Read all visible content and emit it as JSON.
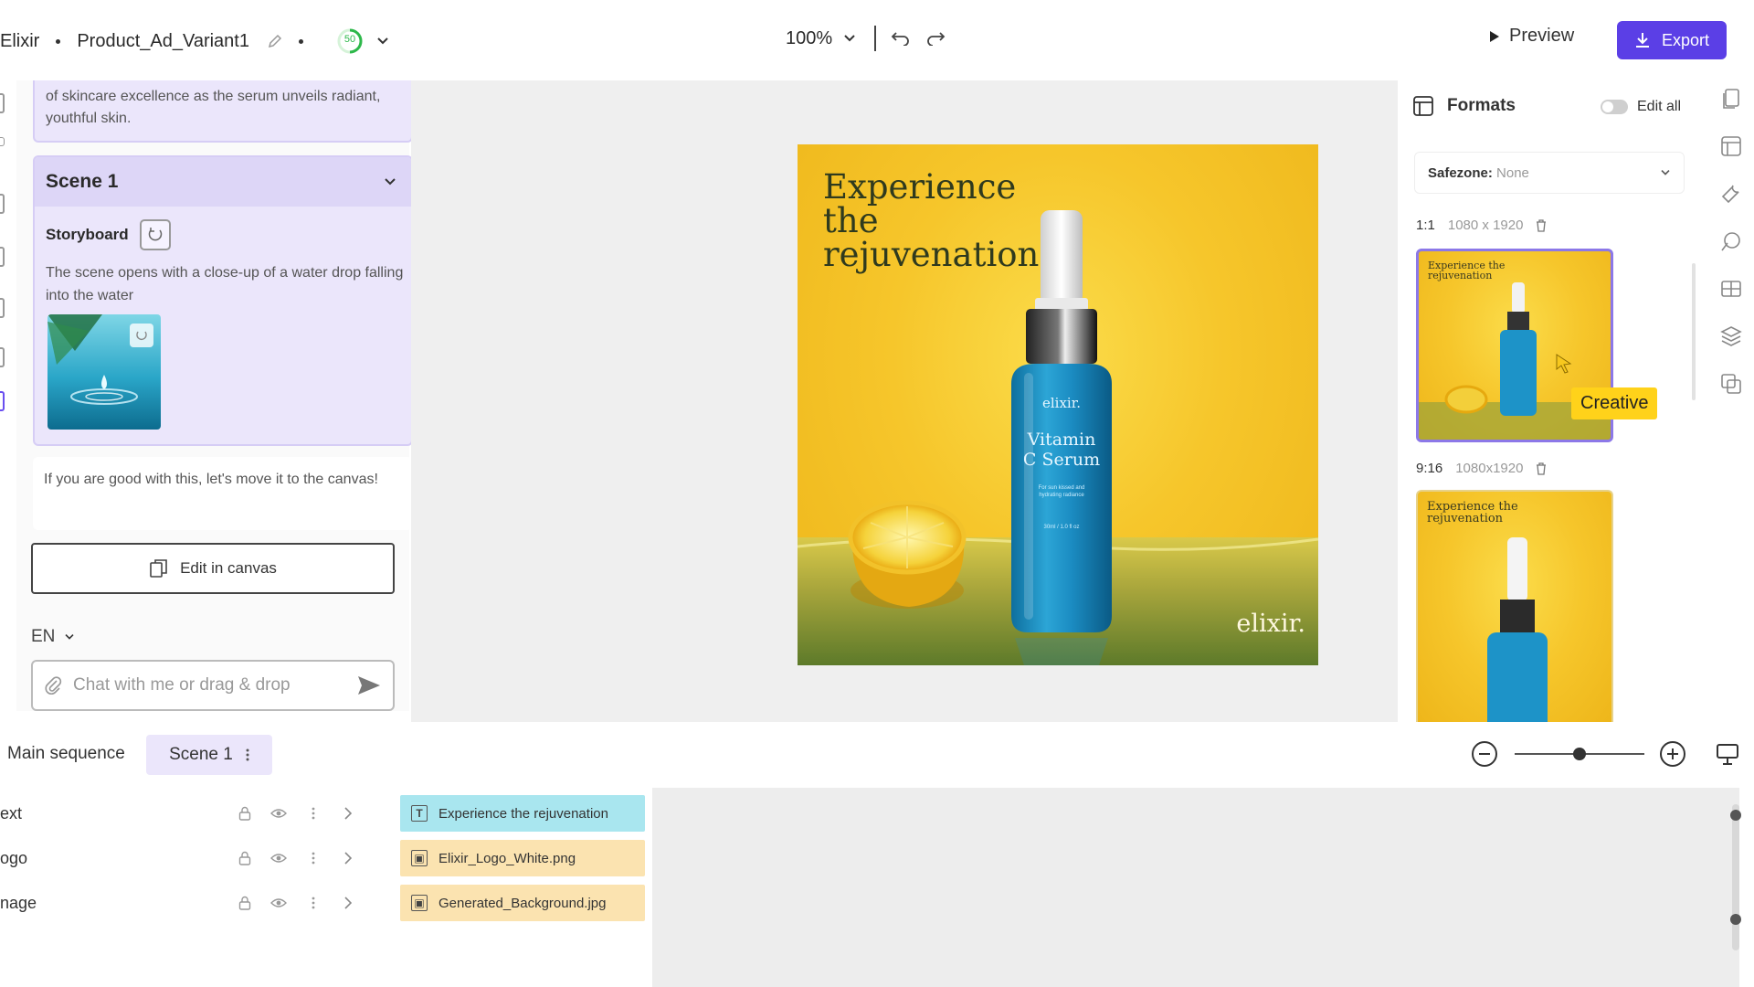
{
  "header": {
    "app_name": "Elixir",
    "project_name": "Product_Ad_Variant1",
    "credits": "50",
    "zoom": "100%",
    "preview_label": "Preview",
    "export_label": "Export",
    "accent": "#5b3fe6"
  },
  "chat": {
    "previous_message": "of skincare excellence as the serum unveils radiant, youthful skin.",
    "scene_title": "Scene 1",
    "storyboard_label": "Storyboard",
    "storyboard_desc": "The scene opens with a close-up of a water drop falling into the water",
    "assistant_message": "If you are good with this, let's move it to the canvas!",
    "edit_in_canvas_label": "Edit in canvas",
    "language": "EN",
    "input_placeholder": "Chat with me or drag & drop"
  },
  "canvas": {
    "headline": "Experience the rejuvenation",
    "bottle_brand": "elixir.",
    "bottle_name": "Vitamin C Serum",
    "bottle_sub": "For sun kissed and hydrating radiance",
    "bottle_volume": "30ml / 1.0 fl oz",
    "logo_text": "elixir."
  },
  "formats": {
    "title": "Formats",
    "edit_all_label": "Edit all",
    "safezone_label": "Safezone:",
    "safezone_value": "None",
    "items": [
      {
        "ratio": "1:1",
        "size": "1080 x 1920",
        "thumb_title": "Experience the rejuvenation"
      },
      {
        "ratio": "9:16",
        "size": "1080x1920",
        "thumb_title": "Experience the rejuvenation"
      }
    ],
    "tooltip": "Creative"
  },
  "sequence": {
    "main_label": "Main sequence",
    "scene_tab": "Scene 1"
  },
  "timeline": {
    "layers": [
      {
        "name": "ext"
      },
      {
        "name": "ogo"
      },
      {
        "name": "nage"
      }
    ],
    "clips": [
      {
        "label": "Experience the rejuvenation",
        "type": "text"
      },
      {
        "label": "Elixir_Logo_White.png",
        "type": "image"
      },
      {
        "label": "Generated_Background.jpg",
        "type": "image"
      }
    ],
    "zoom_level": 0.5
  }
}
